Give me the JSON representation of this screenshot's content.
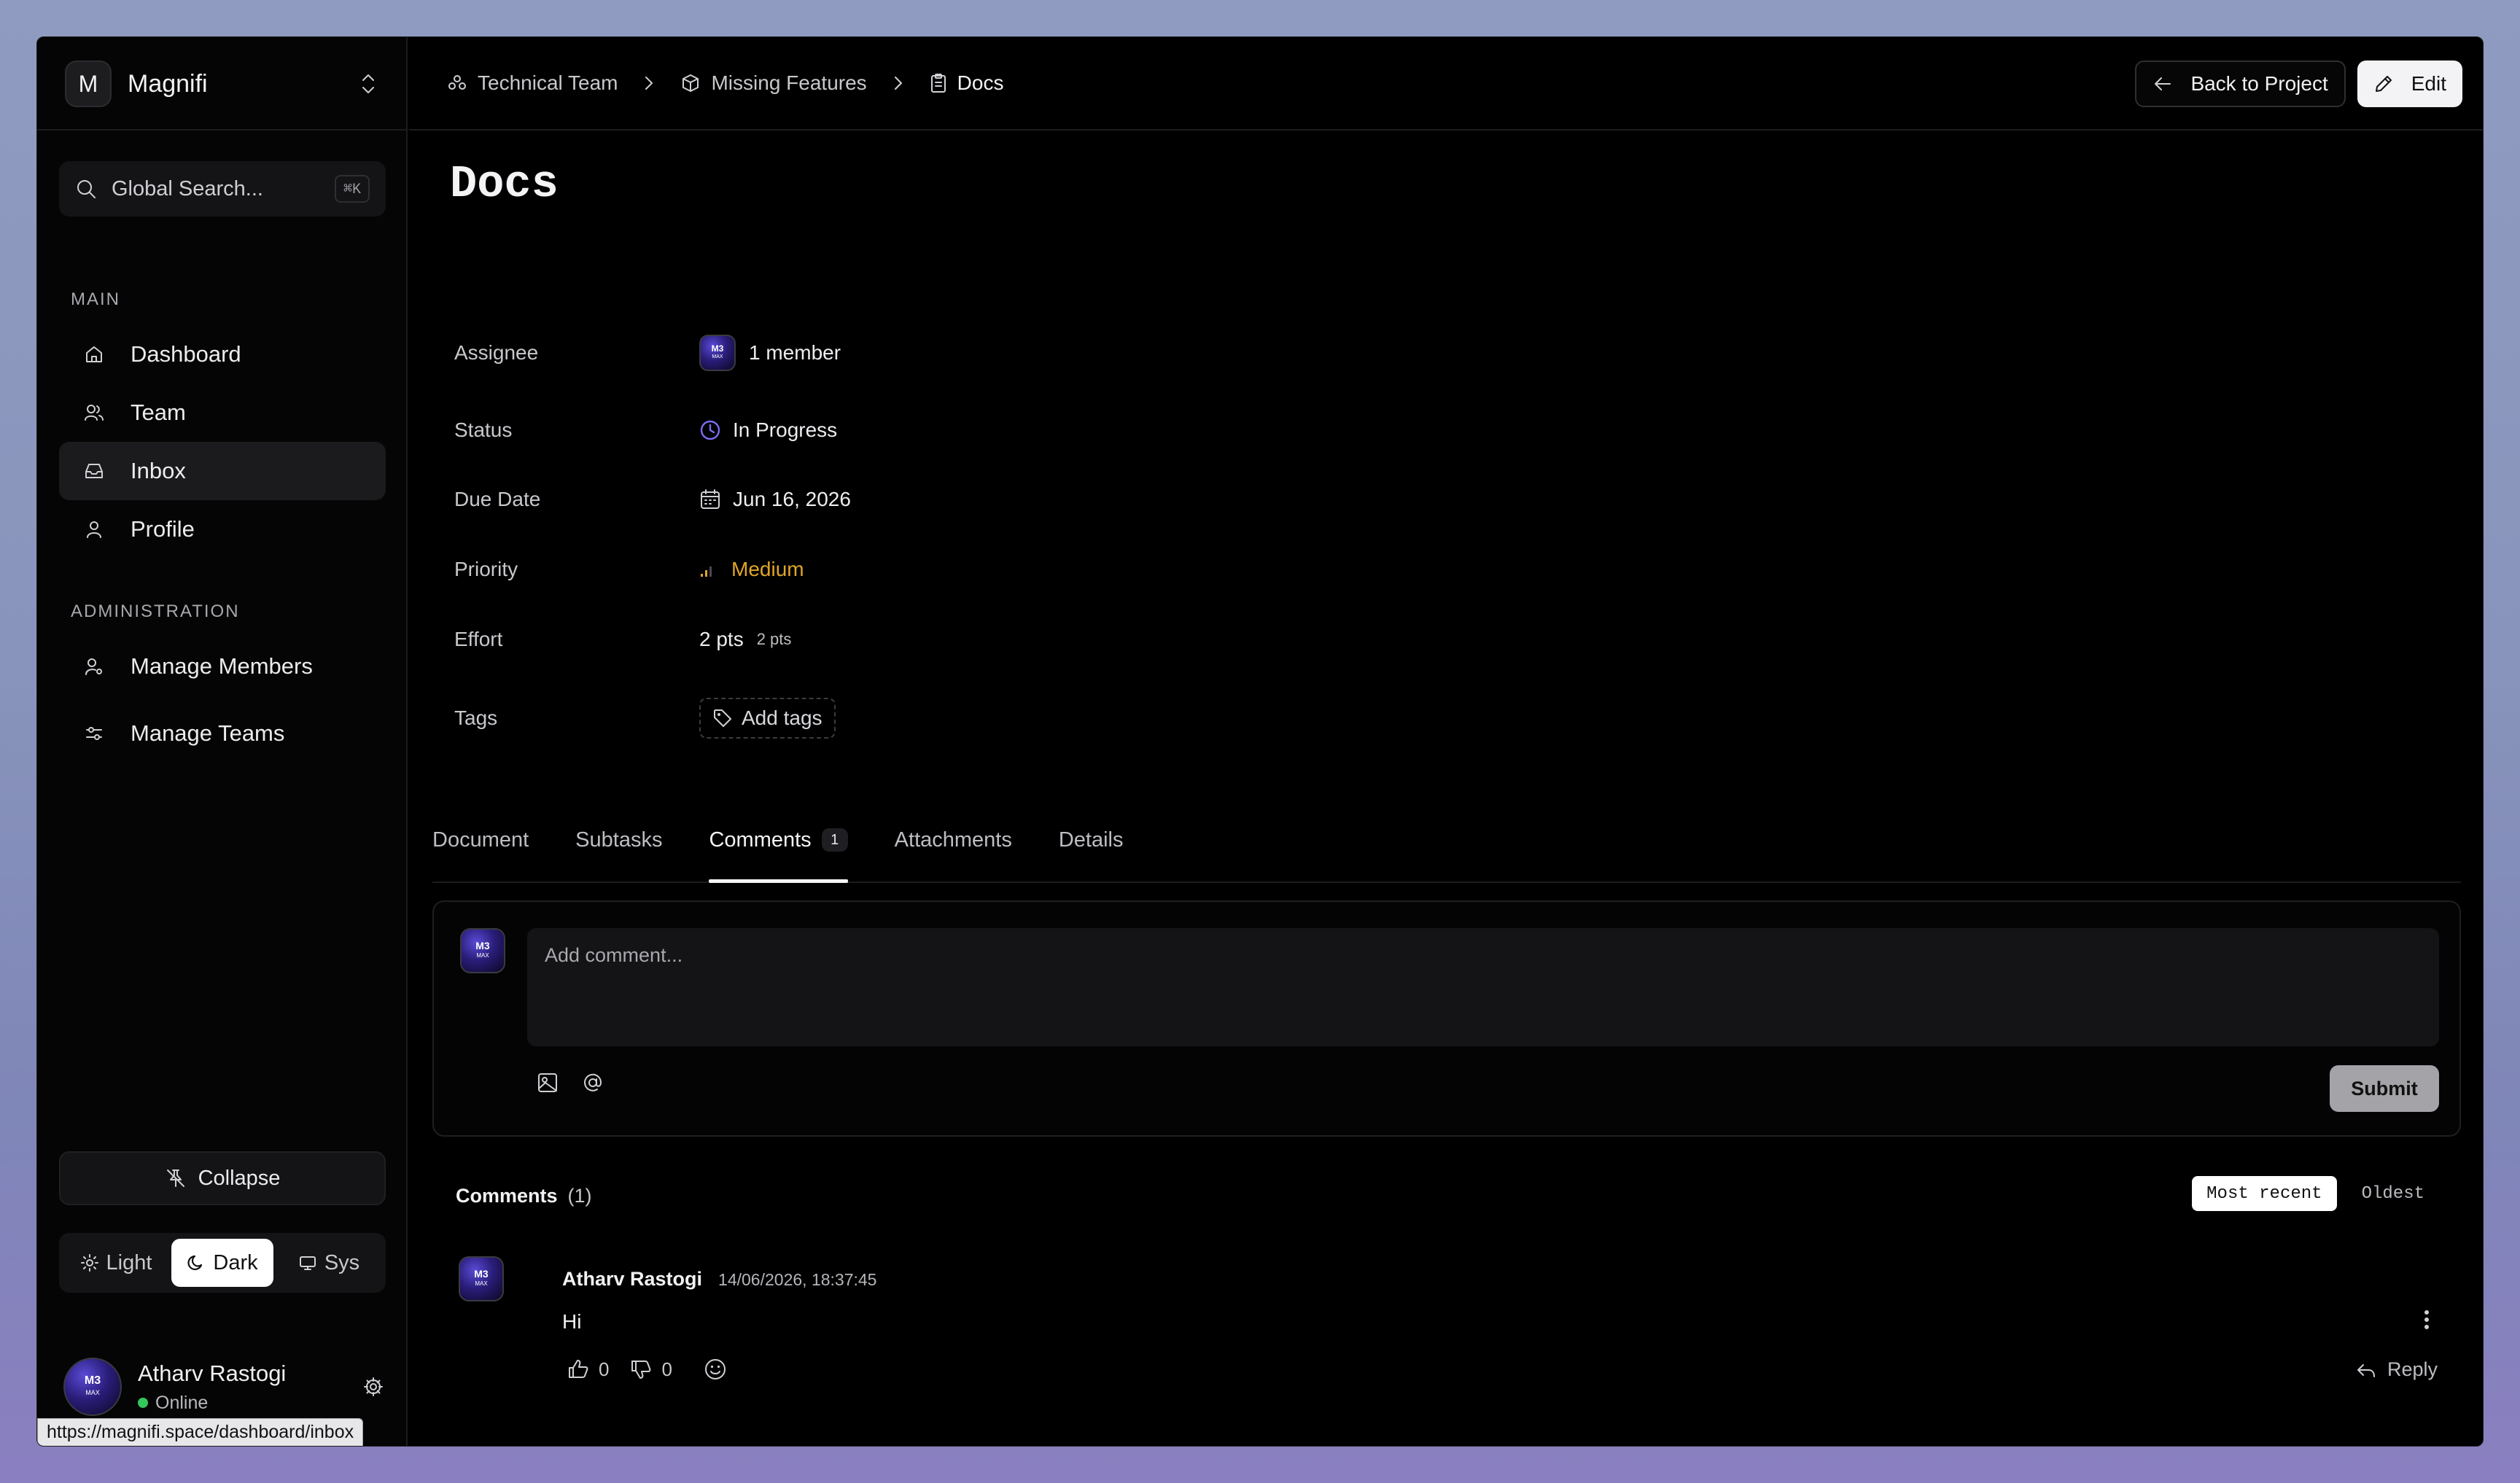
{
  "workspace": {
    "initial": "M",
    "name": "Magnifi"
  },
  "search": {
    "placeholder": "Global Search...",
    "shortcut": "⌘K"
  },
  "sidebar": {
    "main_label": "MAIN",
    "main_items": [
      {
        "label": "Dashboard",
        "icon": "home-icon"
      },
      {
        "label": "Team",
        "icon": "users-icon"
      },
      {
        "label": "Inbox",
        "icon": "inbox-icon",
        "active": true
      },
      {
        "label": "Profile",
        "icon": "user-icon"
      }
    ],
    "admin_label": "ADMINISTRATION",
    "admin_items": [
      {
        "label": "Manage Members",
        "icon": "user-cog-icon"
      },
      {
        "label": "Manage Teams",
        "icon": "sliders-icon"
      }
    ],
    "collapse_label": "Collapse",
    "theme": {
      "light": "Light",
      "dark": "Dark",
      "system": "Sys",
      "selected": "Dark"
    },
    "user": {
      "name": "Atharv Rastogi",
      "status": "Online"
    },
    "url_tooltip": "https://magnifi.space/dashboard/inbox"
  },
  "breadcrumb": [
    {
      "label": "Technical Team",
      "icon": "team-icon"
    },
    {
      "label": "Missing Features",
      "icon": "box-icon"
    },
    {
      "label": "Docs",
      "icon": "clipboard-icon"
    }
  ],
  "toolbar": {
    "back_label": "Back to Project",
    "edit_label": "Edit"
  },
  "task": {
    "title": "Docs",
    "properties": {
      "assignee_label": "Assignee",
      "assignee_value": "1 member",
      "status_label": "Status",
      "status_value": "In Progress",
      "due_label": "Due Date",
      "due_value": "Jun 16, 2026",
      "priority_label": "Priority",
      "priority_value": "Medium",
      "effort_label": "Effort",
      "effort_value": "2 pts",
      "effort_small": "2 pts",
      "tags_label": "Tags",
      "tags_button": "Add tags"
    }
  },
  "colors": {
    "priority": "#e0a528",
    "status": "#7b6cf0",
    "online": "#34c759"
  },
  "tabs": [
    {
      "label": "Document"
    },
    {
      "label": "Subtasks"
    },
    {
      "label": "Comments",
      "badge": "1",
      "selected": true
    },
    {
      "label": "Attachments"
    },
    {
      "label": "Details"
    }
  ],
  "composer": {
    "placeholder": "Add comment...",
    "submit": "Submit"
  },
  "comments": {
    "heading": "Comments",
    "count": "(1)",
    "sort": {
      "recent": "Most recent",
      "oldest": "Oldest",
      "selected": "Most recent"
    },
    "items": [
      {
        "author": "Atharv Rastogi",
        "time": "14/06/2026, 18:37:45",
        "body": "Hi",
        "likes": "0",
        "dislikes": "0",
        "reply": "Reply"
      }
    ]
  },
  "avatar_text": {
    "top": "M3",
    "bottom": "MAX"
  }
}
